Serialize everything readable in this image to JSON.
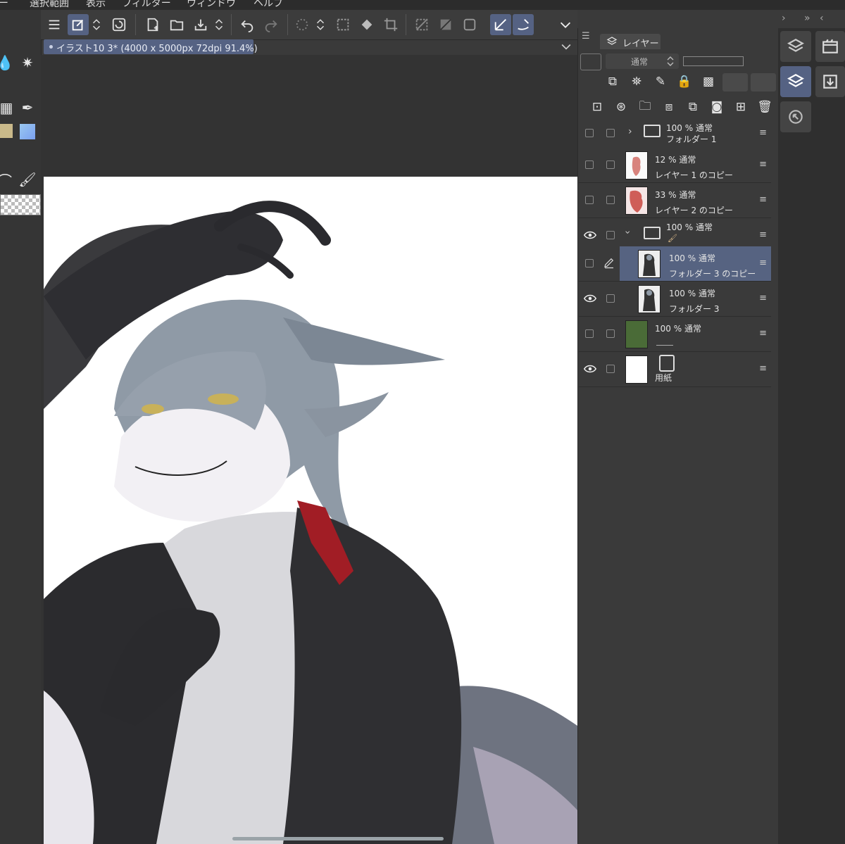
{
  "menu": {
    "items": [
      "ー",
      "選択範囲",
      "表示",
      "フィルター",
      "ウィンドウ",
      "ヘルプ"
    ]
  },
  "document": {
    "tab_title": "イラスト10 3* (4000 x 5000px 72dpi 91.4%)"
  },
  "layer_panel": {
    "tab_label": "レイヤー",
    "blend_mode": "通常",
    "layers": [
      {
        "opacity": "100 %",
        "mode": "通常",
        "name": "フォルダー 1",
        "type": "folder",
        "visible": false,
        "expanded": false
      },
      {
        "opacity": "12 %",
        "mode": "通常",
        "name": "レイヤー 1 のコピー",
        "type": "raster",
        "visible": false
      },
      {
        "opacity": "33 %",
        "mode": "通常",
        "name": "レイヤー 2 のコピー",
        "type": "raster",
        "visible": false
      },
      {
        "opacity": "100 %",
        "mode": "通常",
        "name": "",
        "type": "folder",
        "visible": true,
        "expanded": true
      },
      {
        "opacity": "100 %",
        "mode": "通常",
        "name": "フォルダー 3 のコピー",
        "type": "raster",
        "visible": false,
        "selected": true,
        "editing": true
      },
      {
        "opacity": "100 %",
        "mode": "通常",
        "name": "フォルダー 3",
        "type": "raster",
        "visible": true
      },
      {
        "opacity": "100 %",
        "mode": "通常",
        "name": "",
        "type": "fill",
        "visible": false,
        "color": "#4a6b37"
      },
      {
        "opacity": "",
        "mode": "",
        "name": "用紙",
        "type": "paper",
        "visible": true
      }
    ]
  },
  "colors": {
    "accent": "#556283",
    "panel_bg": "#3a3a3a",
    "fill_layer": "#4a6b37"
  }
}
